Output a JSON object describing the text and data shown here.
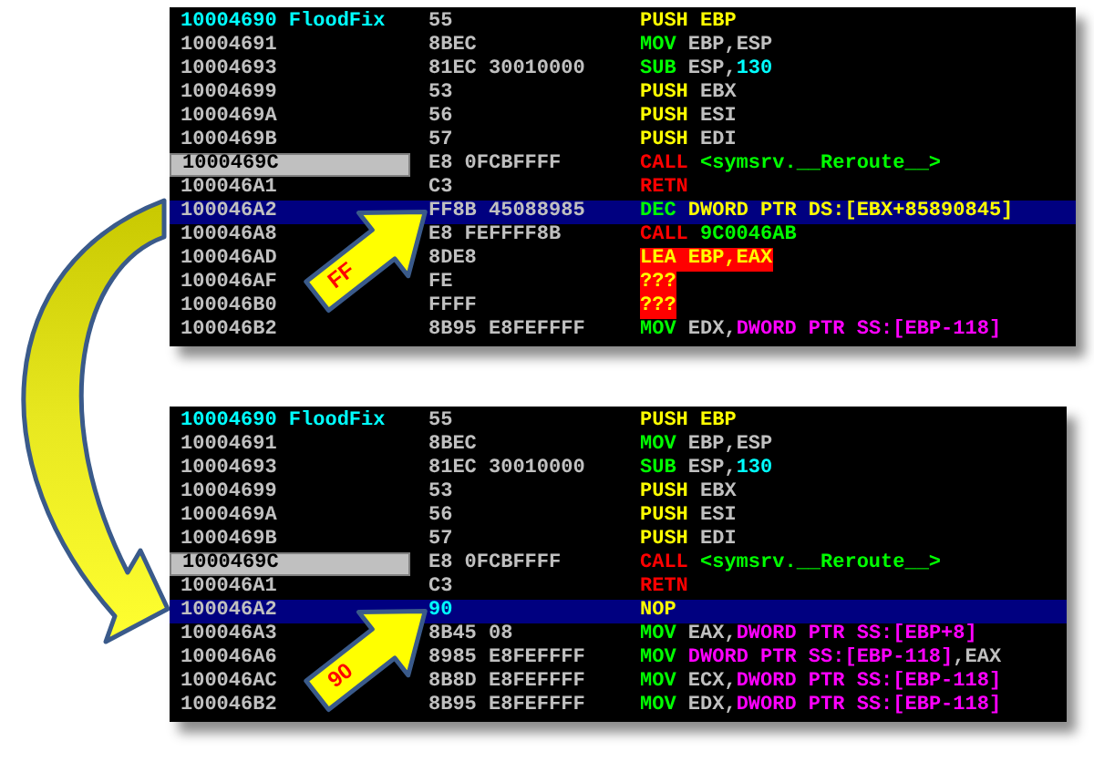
{
  "panels": [
    {
      "callout": {
        "label": "FF"
      },
      "rows": [
        {
          "address": "10004690 FloodFix",
          "label": true,
          "marked": false,
          "selected": false,
          "hex": "55",
          "modified": false,
          "error": false,
          "code": [
            {
              "text": "PUSH",
              "kind": "push"
            },
            {
              "text": " EBP",
              "kind": "push"
            }
          ]
        },
        {
          "address": "10004691",
          "label": false,
          "marked": false,
          "selected": false,
          "hex": "8BEC",
          "modified": false,
          "error": false,
          "code": [
            {
              "text": "MOV",
              "kind": "op"
            },
            {
              "text": " EBP,ESP",
              "kind": "reg"
            }
          ]
        },
        {
          "address": "10004693",
          "label": false,
          "marked": false,
          "selected": false,
          "hex": "81EC 30010000",
          "modified": false,
          "error": false,
          "code": [
            {
              "text": "SUB",
              "kind": "op"
            },
            {
              "text": " ESP,",
              "kind": "reg"
            },
            {
              "text": "130",
              "kind": "const"
            }
          ]
        },
        {
          "address": "10004699",
          "label": false,
          "marked": false,
          "selected": false,
          "hex": "53",
          "modified": false,
          "error": false,
          "code": [
            {
              "text": "PUSH",
              "kind": "push"
            },
            {
              "text": " EBX",
              "kind": "reg"
            }
          ]
        },
        {
          "address": "1000469A",
          "label": false,
          "marked": false,
          "selected": false,
          "hex": "56",
          "modified": false,
          "error": false,
          "code": [
            {
              "text": "PUSH",
              "kind": "push"
            },
            {
              "text": " ESI",
              "kind": "reg"
            }
          ]
        },
        {
          "address": "1000469B",
          "label": false,
          "marked": false,
          "selected": false,
          "hex": "57",
          "modified": false,
          "error": false,
          "code": [
            {
              "text": "PUSH",
              "kind": "push"
            },
            {
              "text": " EDI",
              "kind": "reg"
            }
          ]
        },
        {
          "address": "1000469C",
          "label": false,
          "marked": true,
          "selected": false,
          "hex": "E8 0FCBFFFF",
          "modified": false,
          "error": false,
          "code": [
            {
              "text": "CALL",
              "kind": "jump"
            },
            {
              "text": " <symsrv.__Reroute__>",
              "kind": "target"
            }
          ]
        },
        {
          "address": "100046A1",
          "label": false,
          "marked": false,
          "selected": false,
          "hex": "C3",
          "modified": false,
          "error": false,
          "code": [
            {
              "text": "RETN",
              "kind": "jump"
            }
          ]
        },
        {
          "address": "100046A2",
          "label": false,
          "marked": false,
          "selected": true,
          "hex": "FF8B 45088985",
          "modified": false,
          "error": false,
          "code": [
            {
              "text": "DEC",
              "kind": "op"
            },
            {
              "text": " DWORD PTR DS:[EBX+85890845]",
              "kind": "mem_ds"
            }
          ]
        },
        {
          "address": "100046A8",
          "label": false,
          "marked": false,
          "selected": false,
          "hex": "E8 FEFFFF8B",
          "modified": false,
          "error": false,
          "code": [
            {
              "text": "CALL",
              "kind": "jump"
            },
            {
              "text": " 9C0046AB",
              "kind": "target"
            }
          ]
        },
        {
          "address": "100046AD",
          "label": false,
          "marked": false,
          "selected": false,
          "hex": "8DE8",
          "modified": false,
          "error": true,
          "code": [
            {
              "text": "LEA EBP,EAX",
              "kind": "invalid"
            }
          ]
        },
        {
          "address": "100046AF",
          "label": false,
          "marked": false,
          "selected": false,
          "hex": "FE",
          "modified": false,
          "error": true,
          "code": [
            {
              "text": "???",
              "kind": "invalid"
            }
          ]
        },
        {
          "address": "100046B0",
          "label": false,
          "marked": false,
          "selected": false,
          "hex": "FFFF",
          "modified": false,
          "error": true,
          "code": [
            {
              "text": "???",
              "kind": "invalid"
            }
          ]
        },
        {
          "address": "100046B2",
          "label": false,
          "marked": false,
          "selected": false,
          "hex": "8B95 E8FEFFFF",
          "modified": false,
          "error": false,
          "code": [
            {
              "text": "MOV",
              "kind": "op"
            },
            {
              "text": " EDX,",
              "kind": "reg"
            },
            {
              "text": "DWORD PTR SS:[EBP-118]",
              "kind": "mem_ss"
            }
          ]
        }
      ]
    },
    {
      "callout": {
        "label": "90"
      },
      "rows": [
        {
          "address": "10004690 FloodFix",
          "label": true,
          "marked": false,
          "selected": false,
          "hex": "55",
          "modified": false,
          "error": false,
          "code": [
            {
              "text": "PUSH",
              "kind": "push"
            },
            {
              "text": " EBP",
              "kind": "push"
            }
          ]
        },
        {
          "address": "10004691",
          "label": false,
          "marked": false,
          "selected": false,
          "hex": "8BEC",
          "modified": false,
          "error": false,
          "code": [
            {
              "text": "MOV",
              "kind": "op"
            },
            {
              "text": " EBP,ESP",
              "kind": "reg"
            }
          ]
        },
        {
          "address": "10004693",
          "label": false,
          "marked": false,
          "selected": false,
          "hex": "81EC 30010000",
          "modified": false,
          "error": false,
          "code": [
            {
              "text": "SUB",
              "kind": "op"
            },
            {
              "text": " ESP,",
              "kind": "reg"
            },
            {
              "text": "130",
              "kind": "const"
            }
          ]
        },
        {
          "address": "10004699",
          "label": false,
          "marked": false,
          "selected": false,
          "hex": "53",
          "modified": false,
          "error": false,
          "code": [
            {
              "text": "PUSH",
              "kind": "push"
            },
            {
              "text": " EBX",
              "kind": "reg"
            }
          ]
        },
        {
          "address": "1000469A",
          "label": false,
          "marked": false,
          "selected": false,
          "hex": "56",
          "modified": false,
          "error": false,
          "code": [
            {
              "text": "PUSH",
              "kind": "push"
            },
            {
              "text": " ESI",
              "kind": "reg"
            }
          ]
        },
        {
          "address": "1000469B",
          "label": false,
          "marked": false,
          "selected": false,
          "hex": "57",
          "modified": false,
          "error": false,
          "code": [
            {
              "text": "PUSH",
              "kind": "push"
            },
            {
              "text": " EDI",
              "kind": "reg"
            }
          ]
        },
        {
          "address": "1000469C",
          "label": false,
          "marked": true,
          "selected": false,
          "hex": "E8 0FCBFFFF",
          "modified": false,
          "error": false,
          "code": [
            {
              "text": "CALL",
              "kind": "jump"
            },
            {
              "text": " <symsrv.__Reroute__>",
              "kind": "target"
            }
          ]
        },
        {
          "address": "100046A1",
          "label": false,
          "marked": false,
          "selected": false,
          "hex": "C3",
          "modified": false,
          "error": false,
          "code": [
            {
              "text": "RETN",
              "kind": "jump"
            }
          ]
        },
        {
          "address": "100046A2",
          "label": false,
          "marked": false,
          "selected": true,
          "hex": "90",
          "modified": true,
          "error": false,
          "code": [
            {
              "text": "NOP",
              "kind": "push"
            }
          ]
        },
        {
          "address": "100046A3",
          "label": false,
          "marked": false,
          "selected": false,
          "hex": "8B45 08",
          "modified": false,
          "error": false,
          "code": [
            {
              "text": "MOV",
              "kind": "op"
            },
            {
              "text": " EAX,",
              "kind": "reg"
            },
            {
              "text": "DWORD PTR SS:[EBP+8]",
              "kind": "mem_ss"
            }
          ]
        },
        {
          "address": "100046A6",
          "label": false,
          "marked": false,
          "selected": false,
          "hex": "8985 E8FEFFFF",
          "modified": false,
          "error": false,
          "code": [
            {
              "text": "MOV",
              "kind": "op"
            },
            {
              "text": " DWORD PTR SS:[EBP-118]",
              "kind": "mem_ss"
            },
            {
              "text": ",EAX",
              "kind": "reg"
            }
          ]
        },
        {
          "address": "100046AC",
          "label": false,
          "marked": false,
          "selected": false,
          "hex": "8B8D E8FEFFFF",
          "modified": false,
          "error": false,
          "code": [
            {
              "text": "MOV",
              "kind": "op"
            },
            {
              "text": " ECX,",
              "kind": "reg"
            },
            {
              "text": "DWORD PTR SS:[EBP-118]",
              "kind": "mem_ss"
            }
          ]
        },
        {
          "address": "100046B2",
          "label": false,
          "marked": false,
          "selected": false,
          "hex": "8B95 E8FEFFFF",
          "modified": false,
          "error": false,
          "code": [
            {
              "text": "MOV",
              "kind": "op"
            },
            {
              "text": " EDX,",
              "kind": "reg"
            },
            {
              "text": "DWORD PTR SS:[EBP-118]",
              "kind": "mem_ss"
            }
          ]
        }
      ]
    }
  ]
}
